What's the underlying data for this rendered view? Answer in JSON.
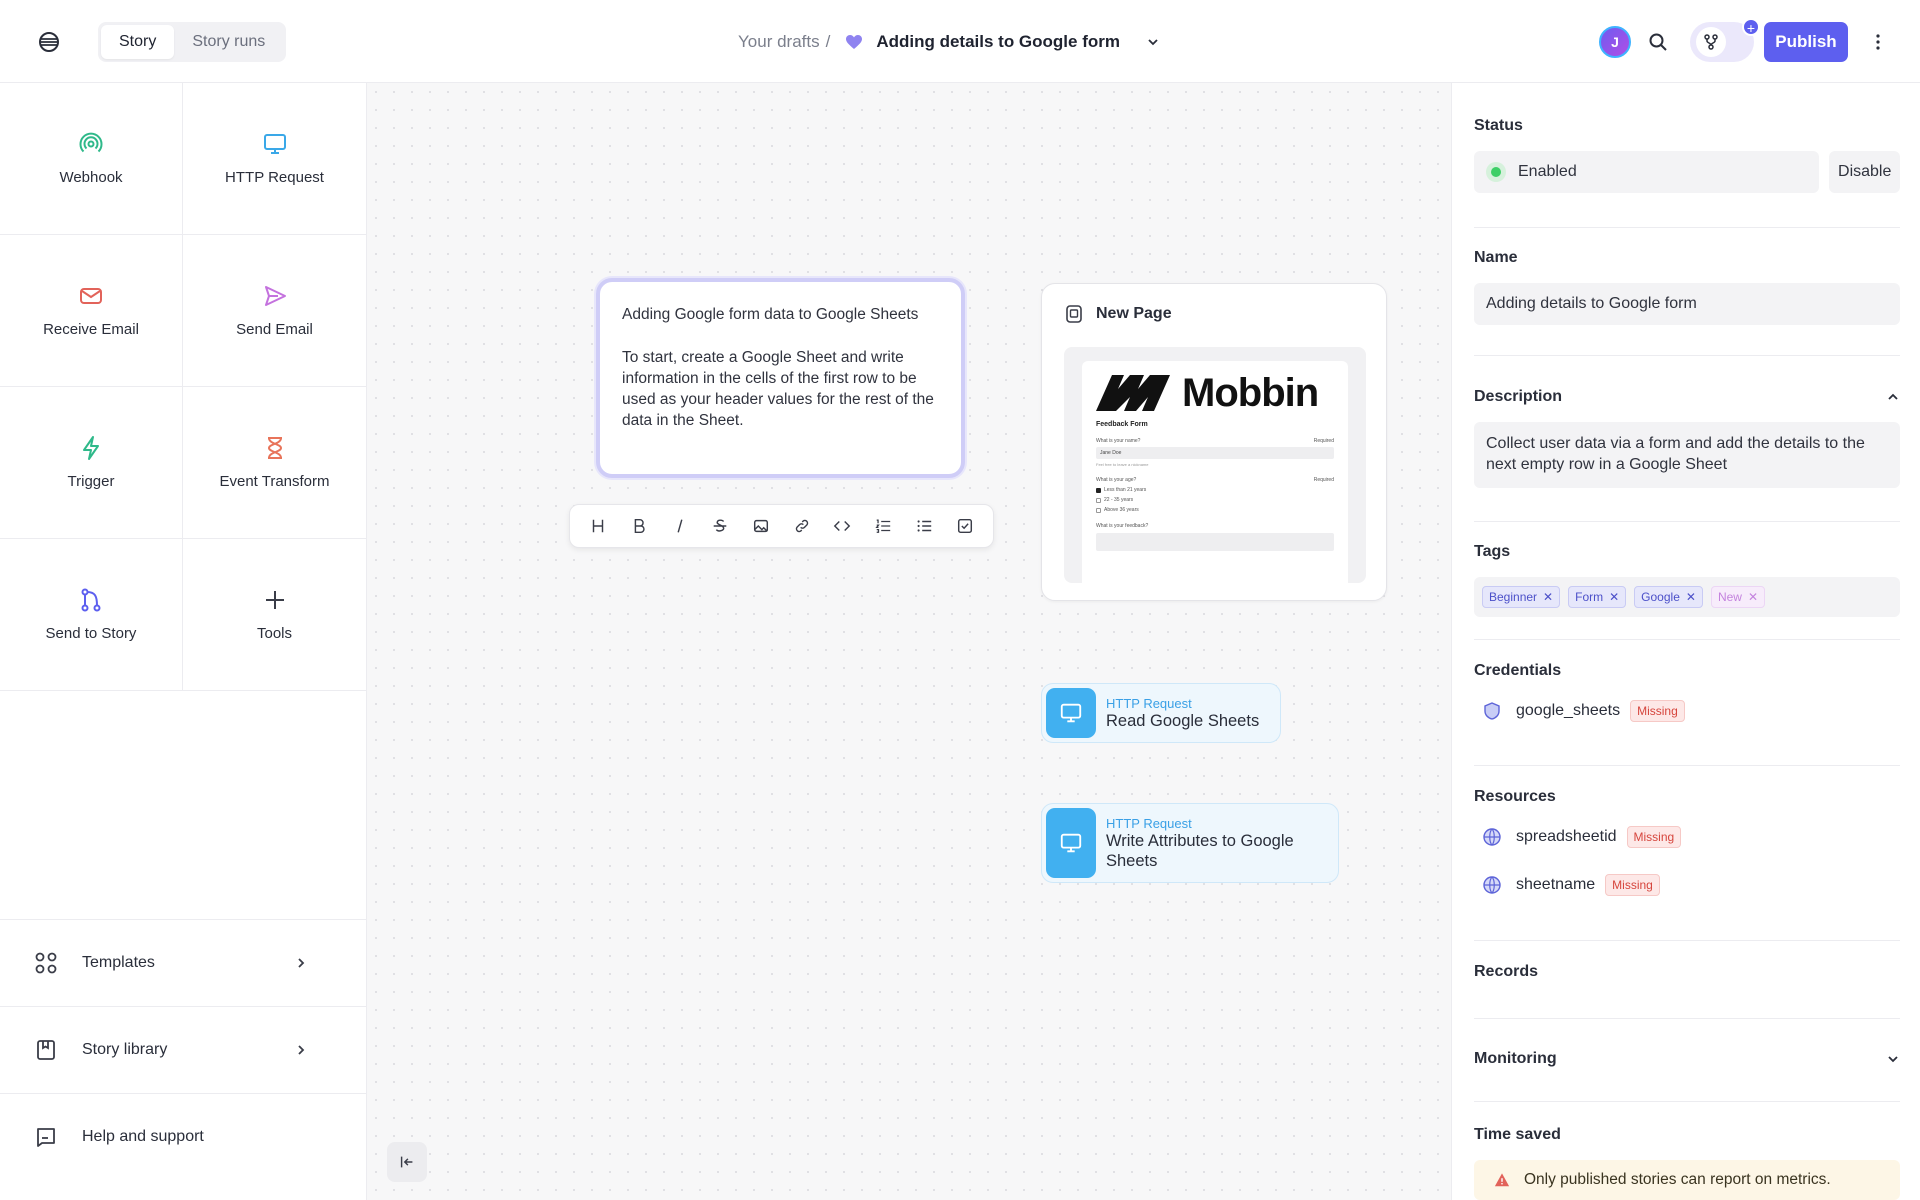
{
  "topbar": {
    "tabs": [
      "Story",
      "Story runs"
    ],
    "active_tab": "Story",
    "breadcrumb_root": "Your drafts",
    "breadcrumb_sep": "/",
    "story_title": "Adding details to Google form",
    "avatar_initial": "J",
    "publish_label": "Publish",
    "branch_plus": "+"
  },
  "sidebar": {
    "tiles": [
      {
        "label": "Webhook",
        "icon": "webhook-icon",
        "color": "#2fb98a"
      },
      {
        "label": "HTTP Request",
        "icon": "monitor-icon",
        "color": "#3aa8e8"
      },
      {
        "label": "Receive Email",
        "icon": "envelope-icon",
        "color": "#e2635a"
      },
      {
        "label": "Send Email",
        "icon": "paper-plane-icon",
        "color": "#c472de"
      },
      {
        "label": "Trigger",
        "icon": "lightning-icon",
        "color": "#2fb98a"
      },
      {
        "label": "Event Transform",
        "icon": "hourglass-icon",
        "color": "#e8745a"
      },
      {
        "label": "Send to Story",
        "icon": "branch-icon",
        "color": "#5d5fef"
      },
      {
        "label": "Tools",
        "icon": "plus-icon",
        "color": "#3a3d48"
      }
    ],
    "links": [
      {
        "label": "Templates",
        "icon": "grid-icon"
      },
      {
        "label": "Story library",
        "icon": "book-icon"
      },
      {
        "label": "Help and support",
        "icon": "chat-icon"
      }
    ]
  },
  "canvas": {
    "note": {
      "paragraph_1": "Adding Google form data to Google Sheets",
      "paragraph_2": "To start, create a Google Sheet and write information in the cells of the first row to be used as your header values for the rest of the data in the Sheet."
    },
    "page_card": {
      "title": "New Page",
      "preview": {
        "brand": "Mobbin",
        "form_title": "Feedback Form",
        "q1": "What is your name?",
        "q1_required": "Required",
        "q1_value": "Jane Doe",
        "q1_help": "Feel free to leave a nickname",
        "q2": "What is your age?",
        "q2_required": "Required",
        "q2_options": [
          "Less than 21 years",
          "22 - 35 years",
          "Above 36 years"
        ],
        "q3": "What is your feedback?"
      }
    },
    "actions": [
      {
        "kind": "HTTP Request",
        "name": "Read Google Sheets"
      },
      {
        "kind": "HTTP Request",
        "name": "Write Attributes to Google Sheets"
      }
    ]
  },
  "panel": {
    "status_heading": "Status",
    "status_value": "Enabled",
    "disable_label": "Disable",
    "name_heading": "Name",
    "name_value": "Adding details to Google form",
    "description_heading": "Description",
    "description_value": "Collect user data via a form and add the details to the next empty row in a Google Sheet",
    "tags_heading": "Tags",
    "tags": [
      "Beginner",
      "Form",
      "Google"
    ],
    "tag_input_placeholder": "New",
    "credentials_heading": "Credentials",
    "credentials": [
      {
        "name": "google_sheets",
        "badge": "Missing"
      }
    ],
    "resources_heading": "Resources",
    "resources": [
      {
        "name": "spreadsheetid",
        "badge": "Missing"
      },
      {
        "name": "sheetname",
        "badge": "Missing"
      }
    ],
    "records_heading": "Records",
    "monitoring_heading": "Monitoring",
    "time_saved_heading": "Time saved",
    "time_saved_warning": "Only published stories can report on metrics."
  },
  "colors": {
    "accent": "#5d5fef",
    "action_blue": "#41b0f0",
    "enabled_green": "#3ccf66",
    "missing_red": "#d6453d"
  }
}
